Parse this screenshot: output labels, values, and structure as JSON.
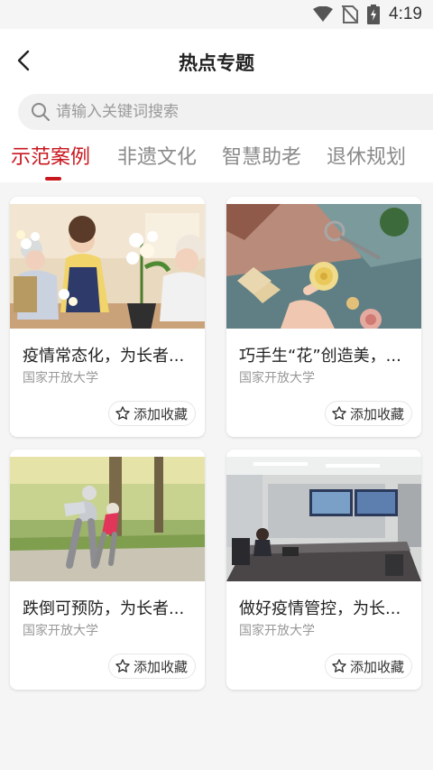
{
  "status_bar": {
    "time": "4:19"
  },
  "header": {
    "title": "热点专题"
  },
  "search": {
    "placeholder": "请输入关键词搜索"
  },
  "tabs": [
    {
      "label": "示范案例",
      "active": true
    },
    {
      "label": "非遗文化",
      "active": false
    },
    {
      "label": "智慧助老",
      "active": false
    },
    {
      "label": "退休规划",
      "active": false
    }
  ],
  "cards": [
    {
      "title": "疫情常态化，为长者...",
      "source": "国家开放大学",
      "fav_label": "添加收藏"
    },
    {
      "title": "巧手生“花”创造美，...",
      "source": "国家开放大学",
      "fav_label": "添加收藏"
    },
    {
      "title": "跌倒可预防，为长者...",
      "source": "国家开放大学",
      "fav_label": "添加收藏"
    },
    {
      "title": "做好疫情管控，为长...",
      "source": "国家开放大学",
      "fav_label": "添加收藏"
    }
  ],
  "colors": {
    "accent": "#c8171e",
    "background": "#f5f5f5"
  }
}
